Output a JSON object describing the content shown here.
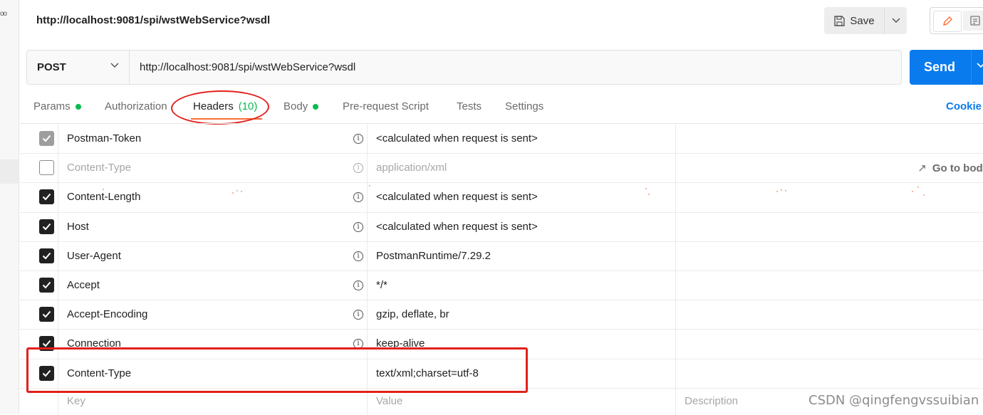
{
  "request": {
    "title": "http://localhost:9081/spi/wstWebService?wsdl",
    "method": "POST",
    "url": "http://localhost:9081/spi/wstWebService?wsdl",
    "save_label": "Save",
    "send_label": "Send"
  },
  "tabs": [
    {
      "label": "Params",
      "dot": true
    },
    {
      "label": "Authorization",
      "dot": false
    },
    {
      "label": "Headers",
      "count": "(10)",
      "active": true
    },
    {
      "label": "Body",
      "dot": true
    },
    {
      "label": "Pre-request Script"
    },
    {
      "label": "Tests"
    },
    {
      "label": "Settings"
    }
  ],
  "cookies_label": "Cookie",
  "headers": [
    {
      "checked": "grey",
      "key": "Postman-Token",
      "value": "<calculated when request is sent>",
      "info": true
    },
    {
      "checked": "off",
      "key": "Content-Type",
      "value": "application/xml",
      "info": true,
      "go_to_body": "Go to body"
    },
    {
      "checked": "on",
      "key": "Content-Length",
      "value": "<calculated when request is sent>",
      "info": true
    },
    {
      "checked": "on",
      "key": "Host",
      "value": "<calculated when request is sent>",
      "info": true
    },
    {
      "checked": "on",
      "key": "User-Agent",
      "value": "PostmanRuntime/7.29.2",
      "info": true
    },
    {
      "checked": "on",
      "key": "Accept",
      "value": "*/*",
      "info": true
    },
    {
      "checked": "on",
      "key": "Accept-Encoding",
      "value": "gzip, deflate, br",
      "info": true
    },
    {
      "checked": "on",
      "key": "Connection",
      "value": "keep-alive",
      "info": true
    },
    {
      "checked": "on",
      "key": "Content-Type",
      "value": "text/xml;charset=utf-8",
      "info": false
    }
  ],
  "new_row": {
    "key_placeholder": "Key",
    "value_placeholder": "Value",
    "desc_placeholder": "Description"
  },
  "watermark": "CSDN @qingfengvssuibian",
  "left_strip_text": "oo",
  "colors": {
    "accent": "#ff6c37",
    "send": "#097bed",
    "active_dot": "#0cbb52",
    "annotation": "#e3201b"
  }
}
